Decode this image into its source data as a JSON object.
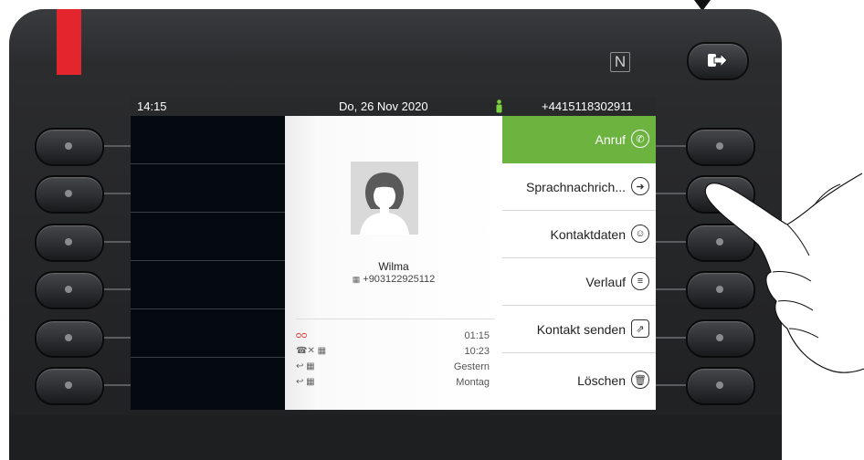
{
  "status_bar": {
    "time": "14:15",
    "date": "Do, 26 Nov 2020",
    "phone_number": "+4415118302911"
  },
  "contact": {
    "name": "Wilma",
    "phone": "+903122925112"
  },
  "call_log": [
    {
      "icon": "voicemail-icon",
      "time": "01:15"
    },
    {
      "icon": "missed-call-icon",
      "time": "10:23"
    },
    {
      "icon": "incoming-call-icon",
      "time": "Gestern"
    },
    {
      "icon": "incoming-call-icon",
      "time": "Montag"
    }
  ],
  "menu": [
    {
      "label": "Anruf",
      "icon": "phone-icon",
      "active": true
    },
    {
      "label": "Sprachnachrich...",
      "icon": "arrow-right-icon",
      "active": false
    },
    {
      "label": "Kontaktdaten",
      "icon": "contact-card-icon",
      "active": false
    },
    {
      "label": "Verlauf",
      "icon": "list-icon",
      "active": false
    },
    {
      "label": "Kontakt senden",
      "icon": "send-contact-icon",
      "active": false
    },
    {
      "label": "Löschen",
      "icon": "trash-icon",
      "active": false
    }
  ],
  "colors": {
    "accent_green": "#6db33f",
    "brand_red": "#e3262d",
    "screen_dark": "#050a10"
  }
}
